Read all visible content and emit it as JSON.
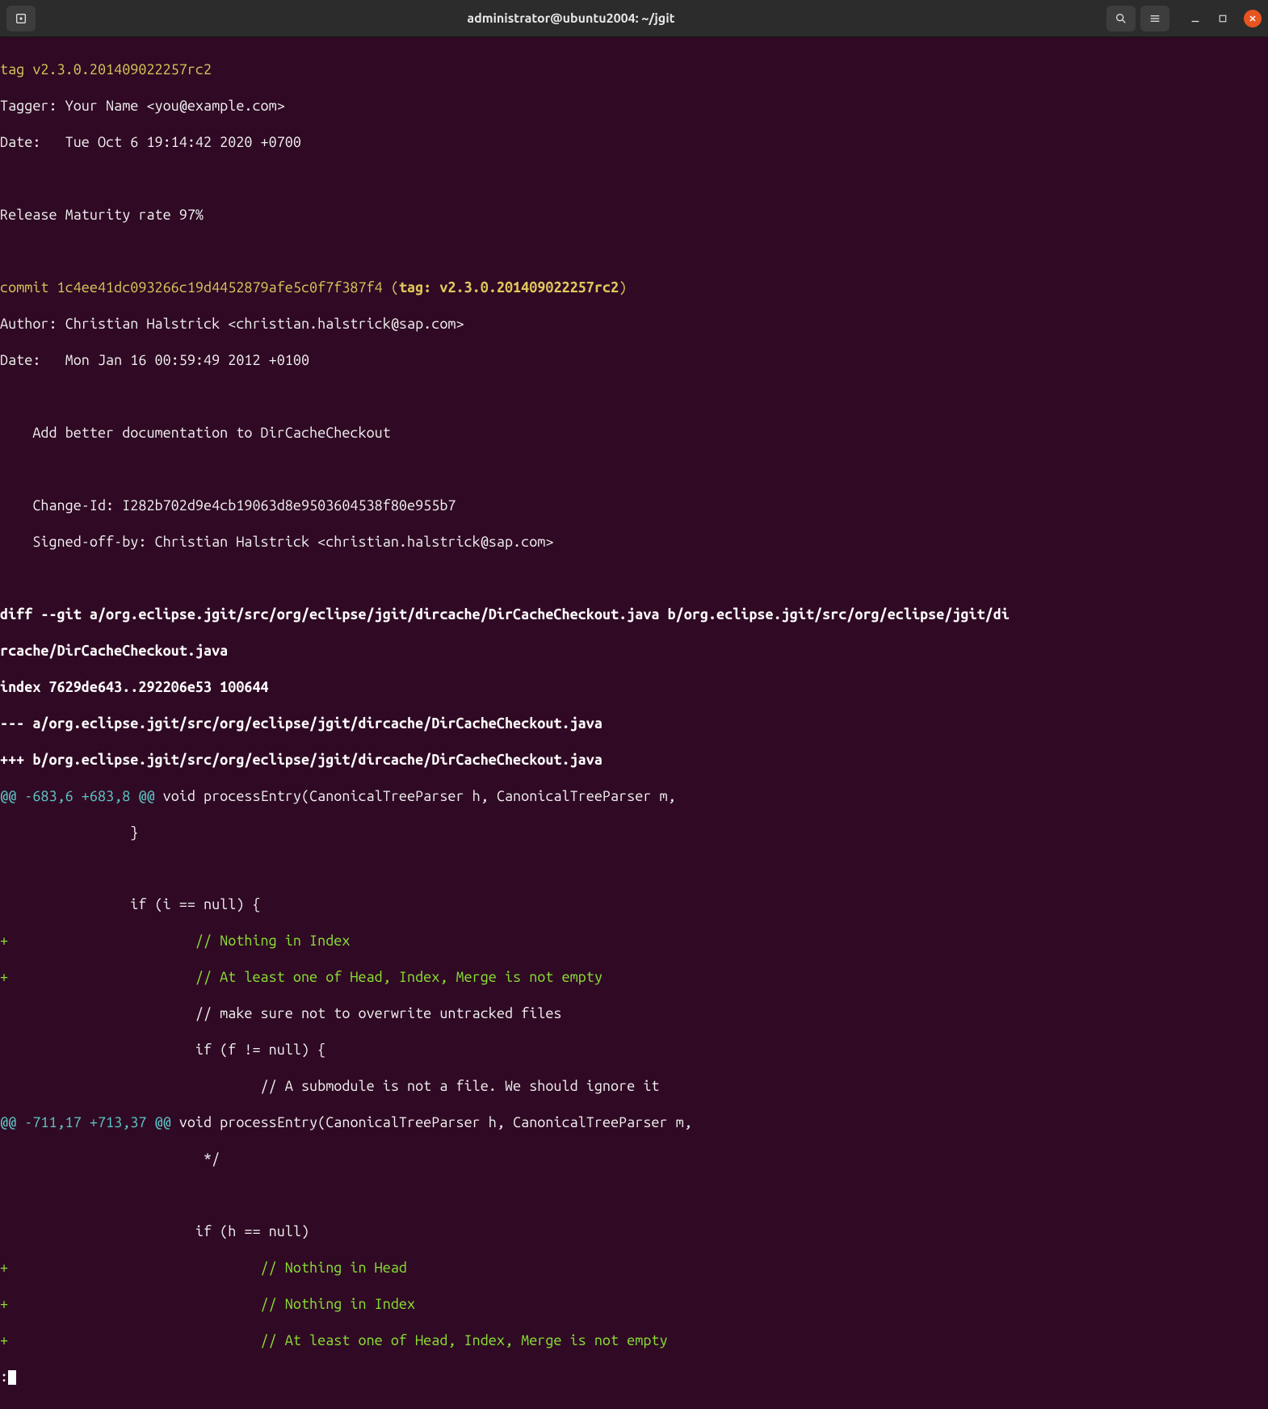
{
  "titlebar": {
    "title": "administrator@ubuntu2004: ~/jgit"
  },
  "terminal": {
    "tag_line": "tag v2.3.0.201409022257rc2",
    "tagger_line": "Tagger: Your Name <you@example.com>",
    "tag_date_line": "Date:   Tue Oct 6 19:14:42 2020 +0700",
    "release_line": "Release Maturity rate 97%",
    "commit_prefix": "commit 1c4ee41dc093266c19d4452879afe5c0f7f387f4 ",
    "commit_paren_open": "(",
    "commit_tag_label": "tag: v2.3.0.201409022257rc2",
    "commit_paren_close": ")",
    "author_line": "Author: Christian Halstrick <christian.halstrick@sap.com>",
    "commit_date_line": "Date:   Mon Jan 16 00:59:49 2012 +0100",
    "commit_msg1": "    Add better documentation to DirCacheCheckout",
    "commit_msg2": "    ",
    "change_id_line": "    Change-Id: I282b702d9e4cb19063d8e9503604538f80e955b7",
    "signed_off_line": "    Signed-off-by: Christian Halstrick <christian.halstrick@sap.com>",
    "diff_line": "diff --git a/org.eclipse.jgit/src/org/eclipse/jgit/dircache/DirCacheCheckout.java b/org.eclipse.jgit/src/org/eclipse/jgit/di",
    "diff_line2": "rcache/DirCacheCheckout.java",
    "index_line": "index 7629de643..292206e53 100644",
    "minus_file": "--- a/org.eclipse.jgit/src/org/eclipse/jgit/dircache/DirCacheCheckout.java",
    "plus_file": "+++ b/org.eclipse.jgit/src/org/eclipse/jgit/dircache/DirCacheCheckout.java",
    "hunk1_header": "@@ -683,6 +683,8 @@",
    "hunk1_context": " void processEntry(CanonicalTreeParser h, CanonicalTreeParser m,",
    "ctx_brace": "                }",
    "ctx_blank": "",
    "ctx_if_i_null": "                if (i == null) {",
    "add_nothing_index": "+                       // Nothing in Index",
    "add_at_least_one": "+                       // At least one of Head, Index, Merge is not empty",
    "ctx_make_sure": "                        // make sure not to overwrite untracked files",
    "ctx_if_f_null": "                        if (f != null) {",
    "ctx_submodule": "                                // A submodule is not a file. We should ignore it",
    "hunk2_header": "@@ -711,17 +713,37 @@",
    "hunk2_context": " void processEntry(CanonicalTreeParser h, CanonicalTreeParser m,",
    "ctx_star_slash": "                         */",
    "ctx_blank2": "",
    "ctx_if_h_null": "                        if (h == null)",
    "add_nothing_head": "+                               // Nothing in Head",
    "add_nothing_index2": "+                               // Nothing in Index",
    "add_at_least_one2": "+                               // At least one of Head, Index, Merge is not empty",
    "prompt": ":"
  }
}
